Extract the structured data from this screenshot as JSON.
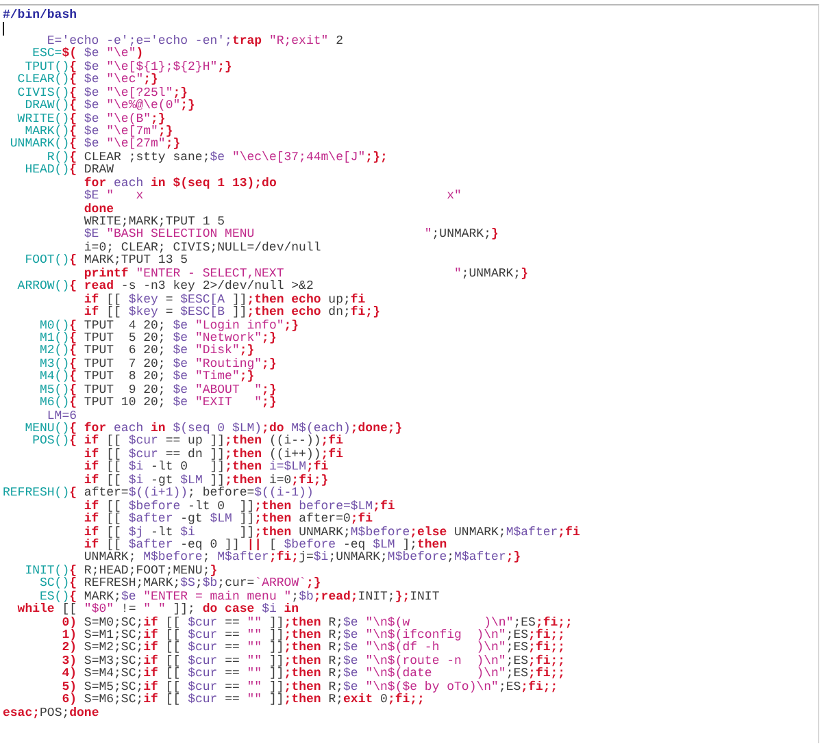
{
  "editor": {
    "lines": [
      {
        "kind": "code",
        "tokens": [
          {
            "kind": "comment",
            "text": "#/bin/bash"
          }
        ]
      },
      {
        "kind": "blank",
        "cursor": true
      },
      {
        "kind": "code",
        "tokens": [
          {
            "kind": "variable",
            "text": "      E='echo -e';e='echo -en';"
          },
          {
            "kind": "keyword",
            "text": "trap "
          },
          {
            "kind": "string",
            "text": "\"R;exit\""
          },
          {
            "kind": "plain",
            "text": " 2"
          }
        ]
      },
      {
        "kind": "code",
        "tokens": [
          {
            "kind": "function",
            "text": "    ESC="
          },
          {
            "kind": "keyword",
            "text": "$( "
          },
          {
            "kind": "variable",
            "text": "$e "
          },
          {
            "kind": "string",
            "text": "\"\\e\""
          },
          {
            "kind": "keyword",
            "text": ")"
          }
        ]
      },
      {
        "kind": "code",
        "tokens": [
          {
            "kind": "function",
            "text": "   TPUT()"
          },
          {
            "kind": "keyword",
            "text": "{ "
          },
          {
            "kind": "variable",
            "text": "$e "
          },
          {
            "kind": "string",
            "text": "\"\\e[${1};${2}H\""
          },
          {
            "kind": "keyword",
            "text": ";}"
          }
        ]
      },
      {
        "kind": "code",
        "tokens": [
          {
            "kind": "function",
            "text": "  CLEAR()"
          },
          {
            "kind": "keyword",
            "text": "{ "
          },
          {
            "kind": "variable",
            "text": "$e "
          },
          {
            "kind": "string",
            "text": "\"\\ec\""
          },
          {
            "kind": "keyword",
            "text": ";}"
          }
        ]
      },
      {
        "kind": "code",
        "tokens": [
          {
            "kind": "function",
            "text": "  CIVIS()"
          },
          {
            "kind": "keyword",
            "text": "{ "
          },
          {
            "kind": "variable",
            "text": "$e "
          },
          {
            "kind": "string",
            "text": "\"\\e[?25l\""
          },
          {
            "kind": "keyword",
            "text": ";}"
          }
        ]
      },
      {
        "kind": "code",
        "tokens": [
          {
            "kind": "function",
            "text": "   DRAW()"
          },
          {
            "kind": "keyword",
            "text": "{ "
          },
          {
            "kind": "variable",
            "text": "$e "
          },
          {
            "kind": "string",
            "text": "\"\\e%@\\e(0\""
          },
          {
            "kind": "keyword",
            "text": ";}"
          }
        ]
      },
      {
        "kind": "code",
        "tokens": [
          {
            "kind": "function",
            "text": "  WRITE()"
          },
          {
            "kind": "keyword",
            "text": "{ "
          },
          {
            "kind": "variable",
            "text": "$e "
          },
          {
            "kind": "string",
            "text": "\"\\e(B\""
          },
          {
            "kind": "keyword",
            "text": ";}"
          }
        ]
      },
      {
        "kind": "code",
        "tokens": [
          {
            "kind": "function",
            "text": "   MARK()"
          },
          {
            "kind": "keyword",
            "text": "{ "
          },
          {
            "kind": "variable",
            "text": "$e "
          },
          {
            "kind": "string",
            "text": "\"\\e[7m\""
          },
          {
            "kind": "keyword",
            "text": ";}"
          }
        ]
      },
      {
        "kind": "code",
        "tokens": [
          {
            "kind": "function",
            "text": " UNMARK()"
          },
          {
            "kind": "keyword",
            "text": "{ "
          },
          {
            "kind": "variable",
            "text": "$e "
          },
          {
            "kind": "string",
            "text": "\"\\e[27m\""
          },
          {
            "kind": "keyword",
            "text": ";}"
          }
        ]
      },
      {
        "kind": "code",
        "tokens": [
          {
            "kind": "function",
            "text": "      R()"
          },
          {
            "kind": "keyword",
            "text": "{ "
          },
          {
            "kind": "plain",
            "text": "CLEAR ;stty sane;"
          },
          {
            "kind": "variable",
            "text": "$e "
          },
          {
            "kind": "string",
            "text": "\"\\ec\\e[37;44m\\e[J\""
          },
          {
            "kind": "keyword",
            "text": ";};"
          }
        ]
      },
      {
        "kind": "code",
        "tokens": [
          {
            "kind": "function",
            "text": "   HEAD()"
          },
          {
            "kind": "keyword",
            "text": "{ "
          },
          {
            "kind": "plain",
            "text": "DRAW"
          }
        ]
      },
      {
        "kind": "code",
        "tokens": [
          {
            "kind": "keyword",
            "text": "           for "
          },
          {
            "kind": "variable",
            "text": "each "
          },
          {
            "kind": "keyword",
            "text": "in $(seq 1 13);do"
          }
        ]
      },
      {
        "kind": "code",
        "tokens": [
          {
            "kind": "variable",
            "text": "           $E "
          },
          {
            "kind": "string",
            "text": "\"   x                                         x\""
          }
        ]
      },
      {
        "kind": "code",
        "tokens": [
          {
            "kind": "keyword",
            "text": "           done"
          }
        ]
      },
      {
        "kind": "code",
        "tokens": [
          {
            "kind": "plain",
            "text": "           WRITE;MARK;TPUT 1 5"
          }
        ]
      },
      {
        "kind": "code",
        "tokens": [
          {
            "kind": "variable",
            "text": "           $E "
          },
          {
            "kind": "string",
            "text": "\"BASH SELECTION MENU                       \""
          },
          {
            "kind": "plain",
            "text": ";UNMARK;"
          },
          {
            "kind": "keyword",
            "text": "}"
          }
        ]
      },
      {
        "kind": "code",
        "tokens": [
          {
            "kind": "plain",
            "text": "           i=0; CLEAR; CIVIS;NULL=/dev/null"
          }
        ]
      },
      {
        "kind": "code",
        "tokens": [
          {
            "kind": "function",
            "text": "   FOOT()"
          },
          {
            "kind": "keyword",
            "text": "{ "
          },
          {
            "kind": "plain",
            "text": "MARK;TPUT 13 5"
          }
        ]
      },
      {
        "kind": "code",
        "tokens": [
          {
            "kind": "keyword",
            "text": "           printf "
          },
          {
            "kind": "string",
            "text": "\"ENTER - SELECT,NEXT                       \""
          },
          {
            "kind": "plain",
            "text": ";UNMARK;"
          },
          {
            "kind": "keyword",
            "text": "}"
          }
        ]
      },
      {
        "kind": "code",
        "tokens": [
          {
            "kind": "function",
            "text": "  ARROW()"
          },
          {
            "kind": "keyword",
            "text": "{ read "
          },
          {
            "kind": "plain",
            "text": "-s -n3 key 2>/dev/null >&2"
          }
        ]
      },
      {
        "kind": "code",
        "tokens": [
          {
            "kind": "keyword",
            "text": "           if"
          },
          {
            "kind": "plain",
            "text": " [[ "
          },
          {
            "kind": "variable",
            "text": "$key"
          },
          {
            "kind": "plain",
            "text": " = "
          },
          {
            "kind": "variable",
            "text": "$ESC[A"
          },
          {
            "kind": "plain",
            "text": " ]]"
          },
          {
            "kind": "keyword",
            "text": ";then echo "
          },
          {
            "kind": "plain",
            "text": "up;"
          },
          {
            "kind": "keyword",
            "text": "fi"
          }
        ]
      },
      {
        "kind": "code",
        "tokens": [
          {
            "kind": "keyword",
            "text": "           if"
          },
          {
            "kind": "plain",
            "text": " [[ "
          },
          {
            "kind": "variable",
            "text": "$key"
          },
          {
            "kind": "plain",
            "text": " = "
          },
          {
            "kind": "variable",
            "text": "$ESC[B"
          },
          {
            "kind": "plain",
            "text": " ]]"
          },
          {
            "kind": "keyword",
            "text": ";then echo "
          },
          {
            "kind": "plain",
            "text": "dn;"
          },
          {
            "kind": "keyword",
            "text": "fi;}"
          }
        ]
      },
      {
        "kind": "code",
        "tokens": [
          {
            "kind": "function",
            "text": "     M0()"
          },
          {
            "kind": "keyword",
            "text": "{ "
          },
          {
            "kind": "plain",
            "text": "TPUT  4 20; "
          },
          {
            "kind": "variable",
            "text": "$e "
          },
          {
            "kind": "string",
            "text": "\"Login info\""
          },
          {
            "kind": "keyword",
            "text": ";}"
          }
        ]
      },
      {
        "kind": "code",
        "tokens": [
          {
            "kind": "function",
            "text": "     M1()"
          },
          {
            "kind": "keyword",
            "text": "{ "
          },
          {
            "kind": "plain",
            "text": "TPUT  5 20; "
          },
          {
            "kind": "variable",
            "text": "$e "
          },
          {
            "kind": "string",
            "text": "\"Network\""
          },
          {
            "kind": "keyword",
            "text": ";}"
          }
        ]
      },
      {
        "kind": "code",
        "tokens": [
          {
            "kind": "function",
            "text": "     M2()"
          },
          {
            "kind": "keyword",
            "text": "{ "
          },
          {
            "kind": "plain",
            "text": "TPUT  6 20; "
          },
          {
            "kind": "variable",
            "text": "$e "
          },
          {
            "kind": "string",
            "text": "\"Disk\""
          },
          {
            "kind": "keyword",
            "text": ";}"
          }
        ]
      },
      {
        "kind": "code",
        "tokens": [
          {
            "kind": "function",
            "text": "     M3()"
          },
          {
            "kind": "keyword",
            "text": "{ "
          },
          {
            "kind": "plain",
            "text": "TPUT  7 20; "
          },
          {
            "kind": "variable",
            "text": "$e "
          },
          {
            "kind": "string",
            "text": "\"Routing\""
          },
          {
            "kind": "keyword",
            "text": ";}"
          }
        ]
      },
      {
        "kind": "code",
        "tokens": [
          {
            "kind": "function",
            "text": "     M4()"
          },
          {
            "kind": "keyword",
            "text": "{ "
          },
          {
            "kind": "plain",
            "text": "TPUT  8 20; "
          },
          {
            "kind": "variable",
            "text": "$e "
          },
          {
            "kind": "string",
            "text": "\"Time\""
          },
          {
            "kind": "keyword",
            "text": ";}"
          }
        ]
      },
      {
        "kind": "code",
        "tokens": [
          {
            "kind": "function",
            "text": "     M5()"
          },
          {
            "kind": "keyword",
            "text": "{ "
          },
          {
            "kind": "plain",
            "text": "TPUT  9 20; "
          },
          {
            "kind": "variable",
            "text": "$e "
          },
          {
            "kind": "string",
            "text": "\"ABOUT  \""
          },
          {
            "kind": "keyword",
            "text": ";}"
          }
        ]
      },
      {
        "kind": "code",
        "tokens": [
          {
            "kind": "function",
            "text": "     M6()"
          },
          {
            "kind": "keyword",
            "text": "{ "
          },
          {
            "kind": "plain",
            "text": "TPUT 10 20; "
          },
          {
            "kind": "variable",
            "text": "$e "
          },
          {
            "kind": "string",
            "text": "\"EXIT   \""
          },
          {
            "kind": "keyword",
            "text": ";}"
          }
        ]
      },
      {
        "kind": "code",
        "tokens": [
          {
            "kind": "variable",
            "text": "      LM=6"
          }
        ]
      },
      {
        "kind": "code",
        "tokens": [
          {
            "kind": "function",
            "text": "   MENU()"
          },
          {
            "kind": "keyword",
            "text": "{ for "
          },
          {
            "kind": "variable",
            "text": "each "
          },
          {
            "kind": "keyword",
            "text": "in "
          },
          {
            "kind": "variable",
            "text": "$(seq 0 $LM)"
          },
          {
            "kind": "keyword",
            "text": ";do "
          },
          {
            "kind": "variable",
            "text": "M$(each)"
          },
          {
            "kind": "keyword",
            "text": ";done;}"
          }
        ]
      },
      {
        "kind": "code",
        "tokens": [
          {
            "kind": "function",
            "text": "    POS()"
          },
          {
            "kind": "keyword",
            "text": "{ if"
          },
          {
            "kind": "plain",
            "text": " [[ "
          },
          {
            "kind": "variable",
            "text": "$cur"
          },
          {
            "kind": "plain",
            "text": " == up ]]"
          },
          {
            "kind": "keyword",
            "text": ";then "
          },
          {
            "kind": "plain",
            "text": "((i--))"
          },
          {
            "kind": "keyword",
            "text": ";fi"
          }
        ]
      },
      {
        "kind": "code",
        "tokens": [
          {
            "kind": "keyword",
            "text": "           if"
          },
          {
            "kind": "plain",
            "text": " [[ "
          },
          {
            "kind": "variable",
            "text": "$cur"
          },
          {
            "kind": "plain",
            "text": " == dn ]]"
          },
          {
            "kind": "keyword",
            "text": ";then "
          },
          {
            "kind": "plain",
            "text": "((i++))"
          },
          {
            "kind": "keyword",
            "text": ";fi"
          }
        ]
      },
      {
        "kind": "code",
        "tokens": [
          {
            "kind": "keyword",
            "text": "           if"
          },
          {
            "kind": "plain",
            "text": " [[ "
          },
          {
            "kind": "variable",
            "text": "$i"
          },
          {
            "kind": "plain",
            "text": " -lt 0   ]]"
          },
          {
            "kind": "keyword",
            "text": ";then "
          },
          {
            "kind": "variable",
            "text": "i=$LM"
          },
          {
            "kind": "keyword",
            "text": ";fi"
          }
        ]
      },
      {
        "kind": "code",
        "tokens": [
          {
            "kind": "keyword",
            "text": "           if"
          },
          {
            "kind": "plain",
            "text": " [[ "
          },
          {
            "kind": "variable",
            "text": "$i"
          },
          {
            "kind": "plain",
            "text": " -gt "
          },
          {
            "kind": "variable",
            "text": "$LM"
          },
          {
            "kind": "plain",
            "text": " ]]"
          },
          {
            "kind": "keyword",
            "text": ";then "
          },
          {
            "kind": "plain",
            "text": "i=0"
          },
          {
            "kind": "keyword",
            "text": ";fi;}"
          }
        ]
      },
      {
        "kind": "code",
        "tokens": [
          {
            "kind": "function",
            "text": "REFRESH()"
          },
          {
            "kind": "keyword",
            "text": "{ "
          },
          {
            "kind": "plain",
            "text": "after="
          },
          {
            "kind": "variable",
            "text": "$((i+1))"
          },
          {
            "kind": "plain",
            "text": "; before="
          },
          {
            "kind": "variable",
            "text": "$((i-1))"
          }
        ]
      },
      {
        "kind": "code",
        "tokens": [
          {
            "kind": "keyword",
            "text": "           if"
          },
          {
            "kind": "plain",
            "text": " [[ "
          },
          {
            "kind": "variable",
            "text": "$before"
          },
          {
            "kind": "plain",
            "text": " -lt 0  ]]"
          },
          {
            "kind": "keyword",
            "text": ";then "
          },
          {
            "kind": "variable",
            "text": "before=$LM"
          },
          {
            "kind": "keyword",
            "text": ";fi"
          }
        ]
      },
      {
        "kind": "code",
        "tokens": [
          {
            "kind": "keyword",
            "text": "           if"
          },
          {
            "kind": "plain",
            "text": " [[ "
          },
          {
            "kind": "variable",
            "text": "$after"
          },
          {
            "kind": "plain",
            "text": " -gt "
          },
          {
            "kind": "variable",
            "text": "$LM"
          },
          {
            "kind": "plain",
            "text": " ]]"
          },
          {
            "kind": "keyword",
            "text": ";then "
          },
          {
            "kind": "plain",
            "text": "after=0"
          },
          {
            "kind": "keyword",
            "text": ";fi"
          }
        ]
      },
      {
        "kind": "code",
        "tokens": [
          {
            "kind": "keyword",
            "text": "           if"
          },
          {
            "kind": "plain",
            "text": " [[ "
          },
          {
            "kind": "variable",
            "text": "$j"
          },
          {
            "kind": "plain",
            "text": " -lt "
          },
          {
            "kind": "variable",
            "text": "$i"
          },
          {
            "kind": "plain",
            "text": "      ]]"
          },
          {
            "kind": "keyword",
            "text": ";then "
          },
          {
            "kind": "plain",
            "text": "UNMARK;"
          },
          {
            "kind": "variable",
            "text": "M$before"
          },
          {
            "kind": "keyword",
            "text": ";else "
          },
          {
            "kind": "plain",
            "text": "UNMARK;"
          },
          {
            "kind": "variable",
            "text": "M$after"
          },
          {
            "kind": "keyword",
            "text": ";fi"
          }
        ]
      },
      {
        "kind": "code",
        "tokens": [
          {
            "kind": "keyword",
            "text": "           if"
          },
          {
            "kind": "plain",
            "text": " [[ "
          },
          {
            "kind": "variable",
            "text": "$after"
          },
          {
            "kind": "plain",
            "text": " -eq 0 ]] "
          },
          {
            "kind": "keyword",
            "text": "|| "
          },
          {
            "kind": "plain",
            "text": "[ "
          },
          {
            "kind": "variable",
            "text": "$before"
          },
          {
            "kind": "plain",
            "text": " -eq "
          },
          {
            "kind": "variable",
            "text": "$LM"
          },
          {
            "kind": "plain",
            "text": " ];"
          },
          {
            "kind": "keyword",
            "text": "then"
          }
        ]
      },
      {
        "kind": "code",
        "tokens": [
          {
            "kind": "plain",
            "text": "           UNMARK; "
          },
          {
            "kind": "variable",
            "text": "M$before"
          },
          {
            "kind": "plain",
            "text": "; "
          },
          {
            "kind": "variable",
            "text": "M$after"
          },
          {
            "kind": "keyword",
            "text": ";fi;"
          },
          {
            "kind": "plain",
            "text": "j="
          },
          {
            "kind": "variable",
            "text": "$i"
          },
          {
            "kind": "plain",
            "text": ";UNMARK;"
          },
          {
            "kind": "variable",
            "text": "M$before"
          },
          {
            "kind": "plain",
            "text": ";"
          },
          {
            "kind": "variable",
            "text": "M$after"
          },
          {
            "kind": "keyword",
            "text": ";}"
          }
        ]
      },
      {
        "kind": "code",
        "tokens": [
          {
            "kind": "function",
            "text": "   INIT()"
          },
          {
            "kind": "keyword",
            "text": "{ "
          },
          {
            "kind": "plain",
            "text": "R;HEAD;FOOT;MENU;"
          },
          {
            "kind": "keyword",
            "text": "}"
          }
        ]
      },
      {
        "kind": "code",
        "tokens": [
          {
            "kind": "function",
            "text": "     SC()"
          },
          {
            "kind": "keyword",
            "text": "{ "
          },
          {
            "kind": "plain",
            "text": "REFRESH;MARK;"
          },
          {
            "kind": "variable",
            "text": "$S"
          },
          {
            "kind": "plain",
            "text": ";"
          },
          {
            "kind": "variable",
            "text": "$b"
          },
          {
            "kind": "plain",
            "text": ";cur="
          },
          {
            "kind": "string",
            "text": "`ARROW`"
          },
          {
            "kind": "keyword",
            "text": ";}"
          }
        ]
      },
      {
        "kind": "code",
        "tokens": [
          {
            "kind": "function",
            "text": "     ES()"
          },
          {
            "kind": "keyword",
            "text": "{ "
          },
          {
            "kind": "plain",
            "text": "MARK;"
          },
          {
            "kind": "variable",
            "text": "$e "
          },
          {
            "kind": "string",
            "text": "\"ENTER = main menu \""
          },
          {
            "kind": "plain",
            "text": ";"
          },
          {
            "kind": "variable",
            "text": "$b"
          },
          {
            "kind": "keyword",
            "text": ";read;"
          },
          {
            "kind": "plain",
            "text": "INIT;"
          },
          {
            "kind": "keyword",
            "text": "};"
          },
          {
            "kind": "plain",
            "text": "INIT"
          }
        ]
      },
      {
        "kind": "code",
        "tokens": [
          {
            "kind": "keyword",
            "text": "  while "
          },
          {
            "kind": "plain",
            "text": "[[ "
          },
          {
            "kind": "string",
            "text": "\"$0\""
          },
          {
            "kind": "plain",
            "text": " != "
          },
          {
            "kind": "string",
            "text": "\" \""
          },
          {
            "kind": "plain",
            "text": " ]]; "
          },
          {
            "kind": "keyword",
            "text": "do case "
          },
          {
            "kind": "variable",
            "text": "$i "
          },
          {
            "kind": "keyword",
            "text": "in"
          }
        ]
      },
      {
        "kind": "code",
        "tokens": [
          {
            "kind": "keyword",
            "text": "        0) "
          },
          {
            "kind": "plain",
            "text": "S=M0;SC;"
          },
          {
            "kind": "keyword",
            "text": "if"
          },
          {
            "kind": "plain",
            "text": " [[ "
          },
          {
            "kind": "variable",
            "text": "$cur"
          },
          {
            "kind": "plain",
            "text": " == "
          },
          {
            "kind": "string",
            "text": "\"\""
          },
          {
            "kind": "plain",
            "text": " ]]"
          },
          {
            "kind": "keyword",
            "text": ";then "
          },
          {
            "kind": "plain",
            "text": "R;"
          },
          {
            "kind": "variable",
            "text": "$e "
          },
          {
            "kind": "string",
            "text": "\"\\n$(w          )\\n\""
          },
          {
            "kind": "plain",
            "text": ";ES"
          },
          {
            "kind": "keyword",
            "text": ";fi;;"
          }
        ]
      },
      {
        "kind": "code",
        "tokens": [
          {
            "kind": "keyword",
            "text": "        1) "
          },
          {
            "kind": "plain",
            "text": "S=M1;SC;"
          },
          {
            "kind": "keyword",
            "text": "if"
          },
          {
            "kind": "plain",
            "text": " [[ "
          },
          {
            "kind": "variable",
            "text": "$cur"
          },
          {
            "kind": "plain",
            "text": " == "
          },
          {
            "kind": "string",
            "text": "\"\""
          },
          {
            "kind": "plain",
            "text": " ]]"
          },
          {
            "kind": "keyword",
            "text": ";then "
          },
          {
            "kind": "plain",
            "text": "R;"
          },
          {
            "kind": "variable",
            "text": "$e "
          },
          {
            "kind": "string",
            "text": "\"\\n$(ifconfig  )\\n\""
          },
          {
            "kind": "plain",
            "text": ";ES"
          },
          {
            "kind": "keyword",
            "text": ";fi;;"
          }
        ]
      },
      {
        "kind": "code",
        "tokens": [
          {
            "kind": "keyword",
            "text": "        2) "
          },
          {
            "kind": "plain",
            "text": "S=M2;SC;"
          },
          {
            "kind": "keyword",
            "text": "if"
          },
          {
            "kind": "plain",
            "text": " [[ "
          },
          {
            "kind": "variable",
            "text": "$cur"
          },
          {
            "kind": "plain",
            "text": " == "
          },
          {
            "kind": "string",
            "text": "\"\""
          },
          {
            "kind": "plain",
            "text": " ]]"
          },
          {
            "kind": "keyword",
            "text": ";then "
          },
          {
            "kind": "plain",
            "text": "R;"
          },
          {
            "kind": "variable",
            "text": "$e "
          },
          {
            "kind": "string",
            "text": "\"\\n$(df -h     )\\n\""
          },
          {
            "kind": "plain",
            "text": ";ES"
          },
          {
            "kind": "keyword",
            "text": ";fi;;"
          }
        ]
      },
      {
        "kind": "code",
        "tokens": [
          {
            "kind": "keyword",
            "text": "        3) "
          },
          {
            "kind": "plain",
            "text": "S=M3;SC;"
          },
          {
            "kind": "keyword",
            "text": "if"
          },
          {
            "kind": "plain",
            "text": " [[ "
          },
          {
            "kind": "variable",
            "text": "$cur"
          },
          {
            "kind": "plain",
            "text": " == "
          },
          {
            "kind": "string",
            "text": "\"\""
          },
          {
            "kind": "plain",
            "text": " ]]"
          },
          {
            "kind": "keyword",
            "text": ";then "
          },
          {
            "kind": "plain",
            "text": "R;"
          },
          {
            "kind": "variable",
            "text": "$e "
          },
          {
            "kind": "string",
            "text": "\"\\n$(route -n  )\\n\""
          },
          {
            "kind": "plain",
            "text": ";ES"
          },
          {
            "kind": "keyword",
            "text": ";fi;;"
          }
        ]
      },
      {
        "kind": "code",
        "tokens": [
          {
            "kind": "keyword",
            "text": "        4) "
          },
          {
            "kind": "plain",
            "text": "S=M4;SC;"
          },
          {
            "kind": "keyword",
            "text": "if"
          },
          {
            "kind": "plain",
            "text": " [[ "
          },
          {
            "kind": "variable",
            "text": "$cur"
          },
          {
            "kind": "plain",
            "text": " == "
          },
          {
            "kind": "string",
            "text": "\"\""
          },
          {
            "kind": "plain",
            "text": " ]]"
          },
          {
            "kind": "keyword",
            "text": ";then "
          },
          {
            "kind": "plain",
            "text": "R;"
          },
          {
            "kind": "variable",
            "text": "$e "
          },
          {
            "kind": "string",
            "text": "\"\\n$(date      )\\n\""
          },
          {
            "kind": "plain",
            "text": ";ES"
          },
          {
            "kind": "keyword",
            "text": ";fi;;"
          }
        ]
      },
      {
        "kind": "code",
        "tokens": [
          {
            "kind": "keyword",
            "text": "        5) "
          },
          {
            "kind": "plain",
            "text": "S=M5;SC;"
          },
          {
            "kind": "keyword",
            "text": "if"
          },
          {
            "kind": "plain",
            "text": " [[ "
          },
          {
            "kind": "variable",
            "text": "$cur"
          },
          {
            "kind": "plain",
            "text": " == "
          },
          {
            "kind": "string",
            "text": "\"\""
          },
          {
            "kind": "plain",
            "text": " ]]"
          },
          {
            "kind": "keyword",
            "text": ";then "
          },
          {
            "kind": "plain",
            "text": "R;"
          },
          {
            "kind": "variable",
            "text": "$e "
          },
          {
            "kind": "string",
            "text": "\"\\n$($e by oTo)\\n\""
          },
          {
            "kind": "plain",
            "text": ";ES"
          },
          {
            "kind": "keyword",
            "text": ";fi;;"
          }
        ]
      },
      {
        "kind": "code",
        "tokens": [
          {
            "kind": "keyword",
            "text": "        6) "
          },
          {
            "kind": "plain",
            "text": "S=M6;SC;"
          },
          {
            "kind": "keyword",
            "text": "if"
          },
          {
            "kind": "plain",
            "text": " [[ "
          },
          {
            "kind": "variable",
            "text": "$cur"
          },
          {
            "kind": "plain",
            "text": " == "
          },
          {
            "kind": "string",
            "text": "\"\""
          },
          {
            "kind": "plain",
            "text": " ]]"
          },
          {
            "kind": "keyword",
            "text": ";then "
          },
          {
            "kind": "plain",
            "text": "R;"
          },
          {
            "kind": "keyword",
            "text": "exit "
          },
          {
            "kind": "plain",
            "text": "0"
          },
          {
            "kind": "keyword",
            "text": ";fi;;"
          }
        ]
      },
      {
        "kind": "code",
        "tokens": [
          {
            "kind": "keyword",
            "text": "esac;"
          },
          {
            "kind": "plain",
            "text": "POS;"
          },
          {
            "kind": "keyword",
            "text": "done"
          }
        ]
      }
    ]
  }
}
